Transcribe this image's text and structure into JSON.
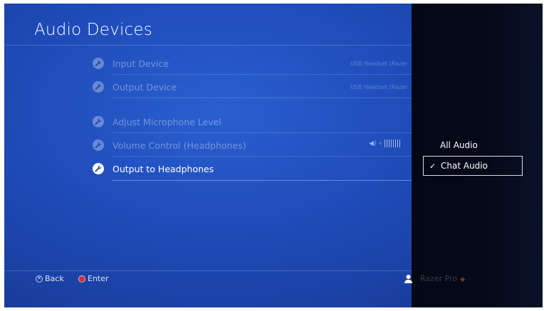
{
  "page": {
    "title": "Audio Devices"
  },
  "settings": [
    {
      "label": "Input Device",
      "value": "USB Headset (Razer",
      "state": "dim"
    },
    {
      "label": "Output Device",
      "value": "USB Headset (Razer",
      "state": "dim"
    },
    {
      "label": "Adjust Microphone Level",
      "state": "dim"
    },
    {
      "label": "Volume Control (Headphones)",
      "state": "dim"
    },
    {
      "label": "Output to Headphones",
      "state": "active"
    }
  ],
  "options_panel": {
    "items": [
      {
        "label": "All Audio",
        "selected": false
      },
      {
        "label": "Chat Audio",
        "selected": true,
        "check": "✓"
      }
    ]
  },
  "footer": {
    "back_symbol": "✕",
    "back_label": "Back",
    "enter_label": "Enter",
    "user_name": "Razer Pro",
    "user_icon": "user-icon"
  },
  "colors": {
    "background": "#1e4bb8",
    "panel": "#050a1a",
    "enter_button": "#c8324a"
  }
}
